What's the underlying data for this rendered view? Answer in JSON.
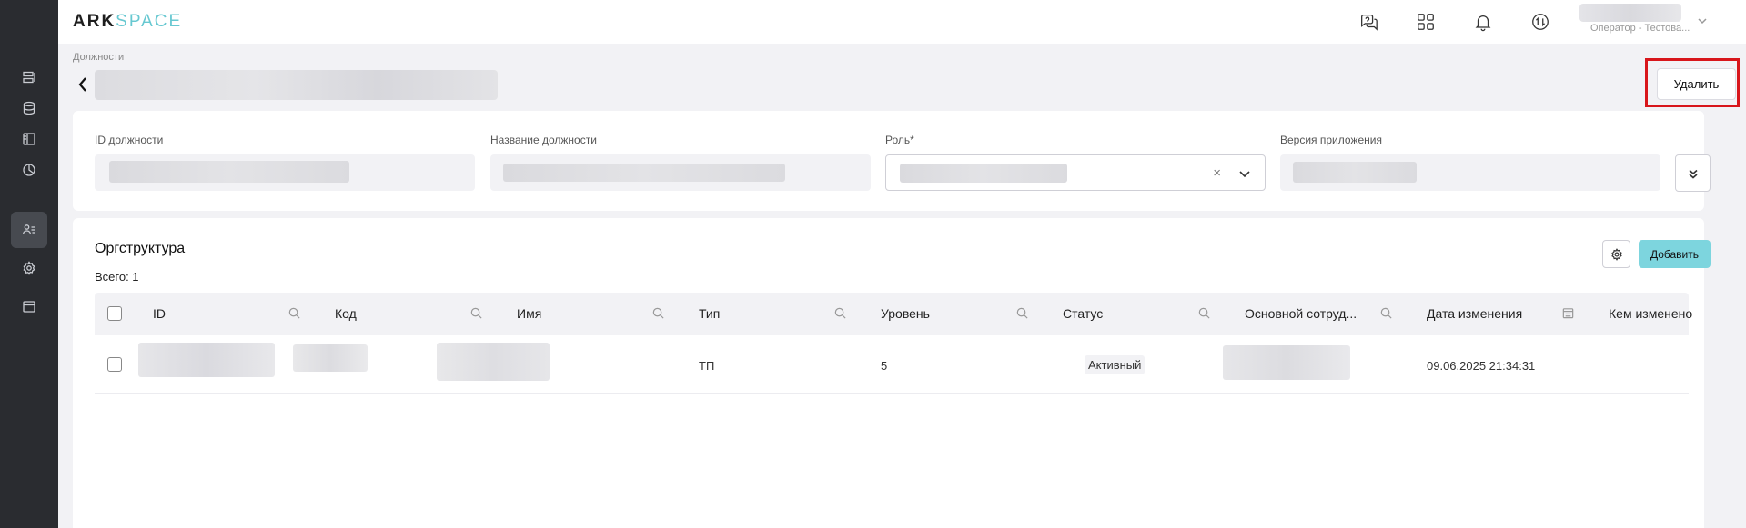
{
  "app": {
    "logo_part1": "ARK",
    "logo_part2": "SPACE"
  },
  "header": {
    "user_role": "Оператор - Тестова...",
    "icons": [
      "support-chat-icon",
      "apps-grid-icon",
      "notifications-bell-icon",
      "exchange-icon"
    ]
  },
  "sidebar": {
    "items": [
      {
        "icon": "list-icon"
      },
      {
        "icon": "database-icon"
      },
      {
        "icon": "layout-icon"
      },
      {
        "icon": "chart-pie-icon"
      },
      {
        "icon": "users-icon",
        "active": true
      },
      {
        "icon": "settings-icon"
      },
      {
        "icon": "calendar-icon"
      }
    ]
  },
  "page": {
    "breadcrumb": "Должности",
    "delete_label": "Удалить"
  },
  "form": {
    "position_id_label": "ID должности",
    "position_name_label": "Название должности",
    "role_label": "Роль*",
    "app_version_label": "Версия приложения",
    "clear_symbol": "×"
  },
  "orgstructure": {
    "title": "Оргструктура",
    "total": "Всего: 1",
    "add_label": "Добавить",
    "columns": [
      "ID",
      "Код",
      "Имя",
      "Тип",
      "Уровень",
      "Статус",
      "Основной сотруд...",
      "Дата изменения",
      "Кем изменено"
    ],
    "rows": [
      {
        "type": "ТП",
        "level": "5",
        "status": "Активный",
        "modified_at": "09.06.2025 21:34:31"
      }
    ]
  }
}
